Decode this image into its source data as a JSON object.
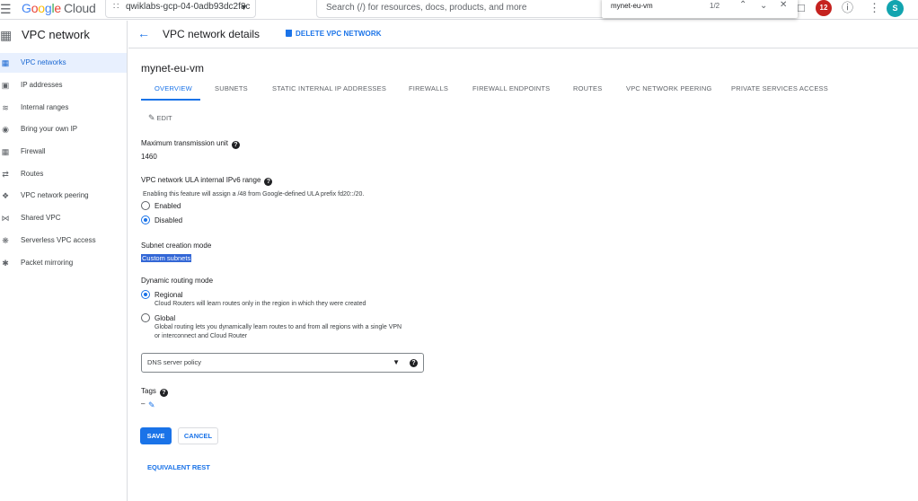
{
  "topbar": {
    "brand_parts": [
      "G",
      "o",
      "o",
      "g",
      "l",
      "e"
    ],
    "brand_suffix": "Cloud",
    "project": "qwiklabs-gcp-04-0adb93dc2f8c",
    "search_placeholder": "Search (/) for resources, docs, products, and more",
    "find_query": "mynet-eu-vm",
    "find_count": "1/2",
    "notification_count": "12",
    "avatar_initial": "S"
  },
  "sidenav": {
    "title": "VPC network",
    "items": [
      {
        "label": "VPC networks",
        "icon": "vpc-networks-icon",
        "active": true
      },
      {
        "label": "IP addresses",
        "icon": "ip-addresses-icon"
      },
      {
        "label": "Internal ranges",
        "icon": "internal-ranges-icon"
      },
      {
        "label": "Bring your own IP",
        "icon": "byoip-icon"
      },
      {
        "label": "Firewall",
        "icon": "firewall-icon"
      },
      {
        "label": "Routes",
        "icon": "routes-icon"
      },
      {
        "label": "VPC network peering",
        "icon": "peering-icon"
      },
      {
        "label": "Shared VPC",
        "icon": "shared-vpc-icon"
      },
      {
        "label": "Serverless VPC access",
        "icon": "serverless-icon"
      },
      {
        "label": "Packet mirroring",
        "icon": "packet-mirroring-icon"
      }
    ]
  },
  "header": {
    "title": "VPC network details",
    "delete_label": "DELETE VPC NETWORK"
  },
  "network": {
    "name": "mynet-eu-vm"
  },
  "tabs": [
    "OVERVIEW",
    "SUBNETS",
    "STATIC INTERNAL IP ADDRESSES",
    "FIREWALLS",
    "FIREWALL ENDPOINTS",
    "ROUTES",
    "VPC NETWORK PEERING",
    "PRIVATE SERVICES ACCESS"
  ],
  "form": {
    "edit_label": "EDIT",
    "mtu_label": "Maximum transmission unit",
    "mtu_value": "1460",
    "ula_label": "VPC network ULA internal IPv6 range",
    "ula_note": "Enabling this feature will assign a /48 from Google-defined ULA prefix fd20::/20.",
    "ula_enabled": "Enabled",
    "ula_disabled": "Disabled",
    "subnet_mode_label": "Subnet creation mode",
    "subnet_mode_value": "Custom subnets",
    "routing_label": "Dynamic routing mode",
    "routing_regional": "Regional",
    "routing_regional_note": "Cloud Routers will learn routes only in the region in which they were created",
    "routing_global": "Global",
    "routing_global_note_1": "Global routing lets you dynamically learn routes to and from all regions with a single VPN",
    "routing_global_note_2": "or interconnect and Cloud Router",
    "dns_placeholder": "DNS server policy",
    "tags_label": "Tags",
    "tags_value": "–",
    "save_label": "SAVE",
    "cancel_label": "CANCEL",
    "rest_label": "EQUIVALENT REST"
  },
  "colors": {
    "accent": "#1a73e8",
    "notification": "#c5221f",
    "avatar": "#12a4af"
  }
}
